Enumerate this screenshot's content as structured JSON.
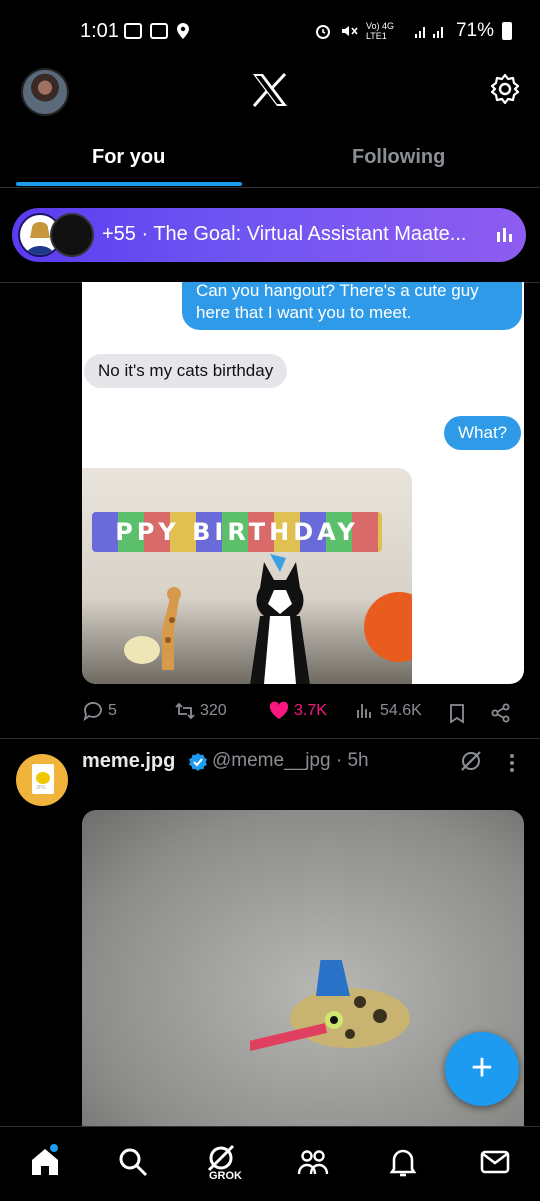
{
  "status_bar": {
    "time": "1:01",
    "network": "Vo) 4G LTE1",
    "battery": "71%"
  },
  "tabs": [
    {
      "label": "For you",
      "selected": true
    },
    {
      "label": "Following",
      "selected": false
    }
  ],
  "spaces_banner": {
    "text": "+55 · The Goal: Virtual Assistant Maate..."
  },
  "post1": {
    "bubbles": {
      "blue1": "Can you hangout? There's a cute guy here that I want you to meet.",
      "gray1": "No it's my cats birthday",
      "blue2": "What?"
    },
    "banner_text": "PPY BIRTHDAY",
    "replies": "5",
    "reposts": "320",
    "likes": "3.7K",
    "views": "54.6K"
  },
  "post2": {
    "name": "meme.jpg",
    "handle": "@meme__jpg · 5h",
    "avatar_text": "JPG"
  },
  "navbar": {
    "grok_label": "GROK"
  },
  "colors": {
    "accent": "#1d9bf0",
    "like": "#f91880",
    "spaces_gradient_start": "#5b3bf0",
    "spaces_gradient_end": "#8e5cf1"
  }
}
